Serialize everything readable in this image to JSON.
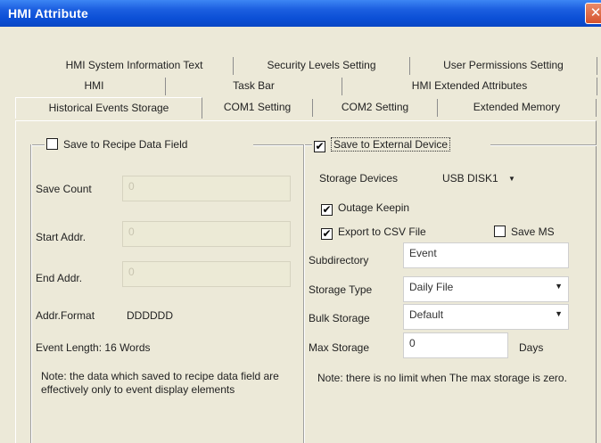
{
  "window": {
    "title": "HMI Attribute",
    "close_glyph": "✕"
  },
  "tabs": {
    "row1": [
      "HMI System Information Text",
      "Security Levels Setting",
      "User Permissions Setting"
    ],
    "row2": [
      "HMI",
      "Task Bar",
      "HMI Extended Attributes"
    ],
    "row3": [
      "Historical Events Storage",
      "COM1 Setting",
      "COM2 Setting",
      "Extended Memory"
    ],
    "active": "Historical Events Storage"
  },
  "left_group": {
    "checkbox_label": "Save to Recipe Data Field",
    "checked": false,
    "save_count_label": "Save Count",
    "save_count_value": "0",
    "start_addr_label": "Start Addr.",
    "start_addr_value": "0",
    "end_addr_label": "End Addr.",
    "end_addr_value": "0",
    "addr_format_label": "Addr.Format",
    "addr_format_value": "DDDDDD",
    "event_length": "Event Length: 16 Words",
    "note": "Note: the data which saved to recipe data field are effectively only to event display elements"
  },
  "right_group": {
    "checkbox_label": "Save to External Device",
    "checked": true,
    "storage_devices_label": "Storage Devices",
    "storage_devices_value": "USB DISK1",
    "outage_keepin_label": "Outage Keepin",
    "outage_keepin_checked": true,
    "export_csv_label": "Export to CSV File",
    "export_csv_checked": true,
    "save_ms_label": "Save MS",
    "save_ms_checked": false,
    "subdirectory_label": "Subdirectory",
    "subdirectory_value": "Event",
    "storage_type_label": "Storage Type",
    "storage_type_value": "Daily File",
    "bulk_storage_label": "Bulk Storage",
    "bulk_storage_value": "Default",
    "max_storage_label": "Max Storage",
    "max_storage_value": "0",
    "max_storage_unit": "Days",
    "note": "Note: there is no limit when The max storage is zero."
  },
  "glyphs": {
    "check": "✔",
    "dropdown": "▼"
  }
}
